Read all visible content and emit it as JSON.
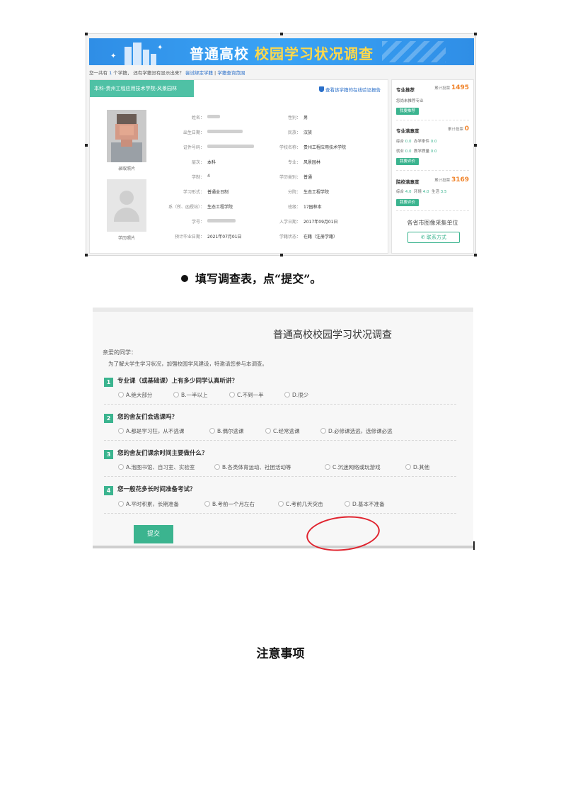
{
  "screenshot1": {
    "banner": {
      "title_part1": "普通高校",
      "title_part2": "校园学习状况调查"
    },
    "hint": {
      "prefix": "您一共有",
      "count": "1",
      "mid": "个学籍， 还有学籍没有显示出来？",
      "link1": "尝试绑定学籍",
      "sep": "|",
      "link2": "学籍查询范围"
    },
    "card": {
      "tab": "本科-贵州工程应用技术学院-风景园林",
      "verify_link": "查看该学籍的在线验证报告",
      "photo1_caption": "录取照片",
      "photo2_caption": "学历照片",
      "fields_left": [
        {
          "label": "姓名：",
          "value": ""
        },
        {
          "label": "出生日期：",
          "value": ""
        },
        {
          "label": "证件号码：",
          "value": ""
        },
        {
          "label": "层次：",
          "value": "本科"
        },
        {
          "label": "学制：",
          "value": "4"
        },
        {
          "label": "学习形式：",
          "value": "普通全日制"
        },
        {
          "label": "系（所、函授站）：",
          "value": "生态工程学院"
        },
        {
          "label": "学号：",
          "value": ""
        },
        {
          "label": "预计毕业日期：",
          "value": "2021年07月01日"
        }
      ],
      "fields_right": [
        {
          "label": "性别：",
          "value": "男"
        },
        {
          "label": "民族：",
          "value": "汉族"
        },
        {
          "label": "学校名称：",
          "value": "贵州工程应用技术学院"
        },
        {
          "label": "专业：",
          "value": "风景园林"
        },
        {
          "label": "学历类别：",
          "value": "普通"
        },
        {
          "label": "分院：",
          "value": "生态工程学院"
        },
        {
          "label": "班级：",
          "value": "17园林本"
        },
        {
          "label": "入学日期：",
          "value": "2017年09月01日"
        },
        {
          "label": "学籍状态：",
          "value": "在籍（注册学籍）"
        }
      ]
    },
    "side": {
      "rec_title": "专业推荐",
      "rec_count_label": "累计投票",
      "rec_count": "1495",
      "rec_text": "您尚未推荐专业",
      "rec_btn": "我要推荐",
      "sat_title": "专业满意度",
      "sat_count_label": "累计投票",
      "sat_count": "0",
      "sat_line1_a": "综合",
      "sat_line1_a_v": "0.0",
      "sat_line1_b": "办学条件",
      "sat_line1_b_v": "0.0",
      "sat_line2_a": "就业",
      "sat_line2_a_v": "0.0",
      "sat_line2_b": "教学质量",
      "sat_line2_b_v": "0.0",
      "sat_btn": "我要评价",
      "school_title": "院校满意度",
      "school_count_label": "累计投票",
      "school_count": "3169",
      "school_a": "综合",
      "school_a_v": "4.0",
      "school_b": "环境",
      "school_b_v": "4.0",
      "school_c": "生活",
      "school_c_v": "3.5",
      "school_btn": "我要评价",
      "unit_text": "各省市图像采集单位",
      "contact_btn": "联系方式"
    }
  },
  "caption": "填写调查表，点“提交”。",
  "screenshot2": {
    "title": "普通高校校园学习状况调查",
    "dear": "亲爱的同学：",
    "intro": "为了解大学生学习状况，加强校园学风建设，特邀请您参与本调查。",
    "questions": [
      {
        "num": "1",
        "text": "专业课（或基础课）上有多少同学认真听讲？",
        "options": [
          "A.绝大部分",
          "B.一半以上",
          "C.不到一半",
          "D.很少"
        ]
      },
      {
        "num": "2",
        "text": "您的舍友们会逃课吗？",
        "options": [
          "A.都是学习狂，从不逃课",
          "B.偶尔逃课",
          "C.经常逃课",
          "D.必修课选逃，选修课必逃"
        ]
      },
      {
        "num": "3",
        "text": "您的舍友们课余时间主要做什么？",
        "options": [
          "A.泡图书馆、自习室、实验室",
          "B.各类体育运动、社团活动等",
          "C.沉迷网络或玩游戏",
          "D.其他"
        ]
      },
      {
        "num": "4",
        "text": "您一般花多长时间准备考试？",
        "options": [
          "A.平时积累，长期准备",
          "B.考前一个月左右",
          "C.考前几天突击",
          "D.基本不准备"
        ]
      }
    ],
    "submit": "提交"
  },
  "notes_heading": "注意事项"
}
